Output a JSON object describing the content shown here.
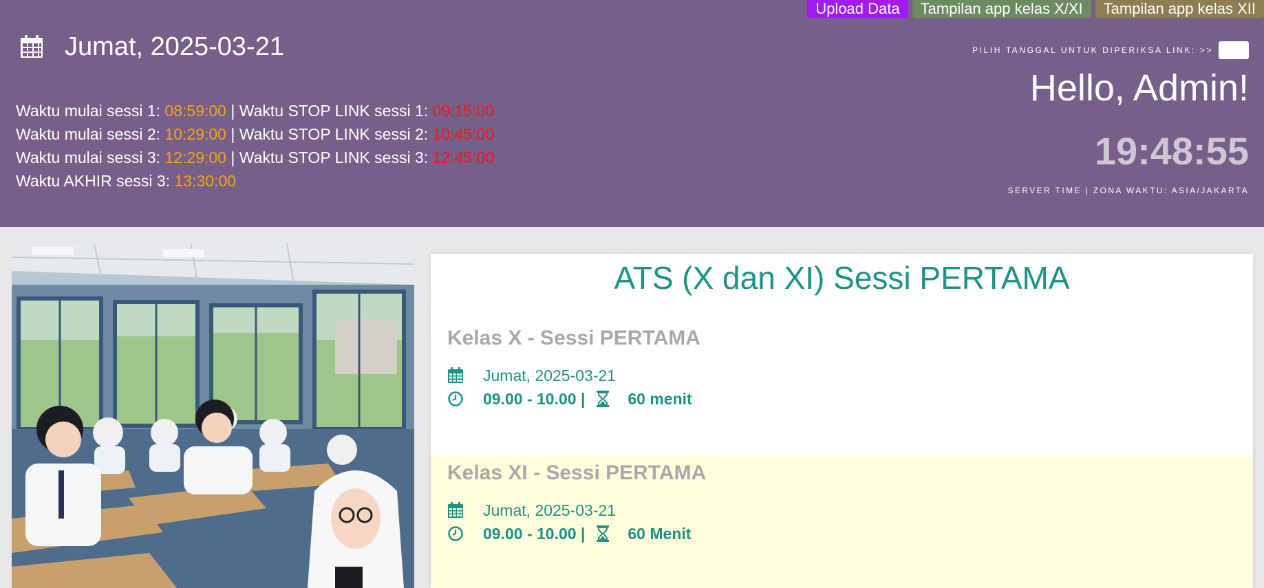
{
  "top_buttons": {
    "upload": "Upload Data",
    "kelas_x_xi": "Tampilan app kelas X/XI",
    "kelas_xii": "Tampilan app kelas XII"
  },
  "header": {
    "date": "Jumat, 2025-03-21",
    "sessions": [
      {
        "start_label": "Waktu mulai sessi 1: ",
        "start": "08:59:00",
        "sep": " | ",
        "stop_label": "Waktu STOP LINK sessi 1: ",
        "stop": "09:15:00"
      },
      {
        "start_label": "Waktu mulai sessi 2: ",
        "start": "10:29:00",
        "sep": " | ",
        "stop_label": "Waktu STOP LINK sessi 2: ",
        "stop": "10:45:00"
      },
      {
        "start_label": "Waktu mulai sessi 3: ",
        "start": "12:29:00",
        "sep": " | ",
        "stop_label": "Waktu STOP LINK sessi 3: ",
        "stop": "12:45:00"
      }
    ],
    "end_label": "Waktu AKHIR sessi 3: ",
    "end_time": "13:30:00",
    "pick_date_label": "PILIH TANGGAL UNTUK DIPERIKSA LINK: >>",
    "greeting": "Hello, Admin!",
    "clock": "19:48:55",
    "server_time": "SERVER TIME | ZONA WAKTU: ASIA/JAKARTA"
  },
  "card": {
    "title": "ATS (X dan XI) Sessi PERTAMA",
    "kelas": [
      {
        "title": "Kelas X - Sessi PERTAMA",
        "date": "Jumat, 2025-03-21",
        "time": "09.00 - 10.00 |",
        "duration": "60 menit"
      },
      {
        "title": "Kelas XI - Sessi PERTAMA",
        "date": "Jumat, 2025-03-21",
        "time": "09.00 - 10.00 |",
        "duration": "60 Menit"
      }
    ]
  },
  "colors": {
    "header_bg": "#765f88",
    "accent_teal": "#1d9285",
    "time_orange": "#f6a21a",
    "stop_red": "#ee1820",
    "upload_btn": "#a21bf2"
  },
  "icons": [
    "calendar-icon",
    "clock-icon",
    "hourglass-icon"
  ]
}
